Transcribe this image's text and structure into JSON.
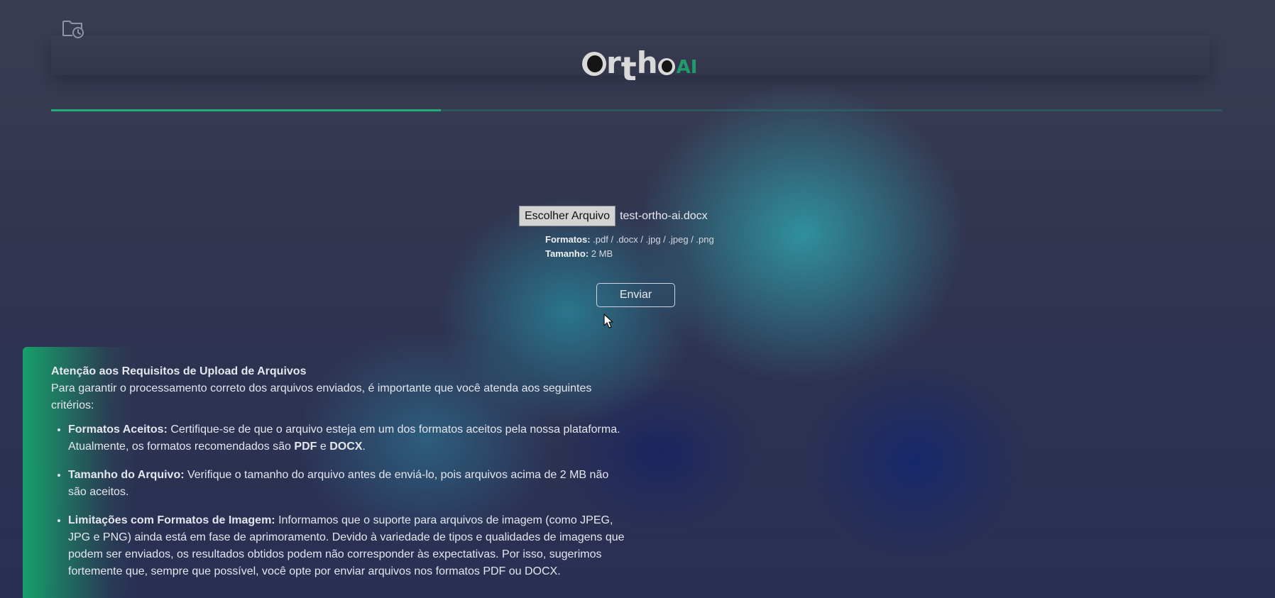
{
  "logo": {
    "letters": [
      "r",
      "t",
      "h"
    ],
    "suffix": "AI",
    "accent_color": "#1f9a6b"
  },
  "header": {
    "history_icon": "folder-clock-icon"
  },
  "progress": {
    "value_fraction": 0.333,
    "color": "#1fae78"
  },
  "upload": {
    "choose_label": "Escolher Arquivo",
    "file_name": "test-ortho-ai.docx",
    "formats_label": "Formatos:",
    "formats_value": ".pdf / .docx / .jpg / .jpeg / .png",
    "size_label": "Tamanho:",
    "size_value": "2 MB",
    "send_label": "Enviar"
  },
  "notice": {
    "title": "Atenção aos Requisitos de Upload de Arquivos",
    "intro": "Para garantir o processamento correto dos arquivos enviados, é importante que você atenda aos seguintes critérios:",
    "items": [
      {
        "label": "Formatos Aceitos:",
        "text": " Certifique-se de que o arquivo esteja em um dos formatos aceitos pela nossa plataforma. Atualmente, os formatos recomendados são ",
        "pdf": "PDF",
        "and": " e ",
        "docx": "DOCX",
        "end": "."
      },
      {
        "label": "Tamanho do Arquivo:",
        "text": " Verifique o tamanho do arquivo antes de enviá-lo, pois arquivos acima de 2 MB não são aceitos."
      },
      {
        "label": "Limitações com Formatos de Imagem:",
        "text": " Informamos que o suporte para arquivos de imagem (como JPEG, JPG e PNG) ainda está em fase de aprimoramento. Devido à variedade de tipos e qualidades de imagens que podem ser enviados, os resultados obtidos podem não corresponder às expectativas. Por isso, sugerimos fortemente que, sempre que possível, você opte por enviar arquivos nos formatos PDF ou DOCX."
      }
    ]
  }
}
